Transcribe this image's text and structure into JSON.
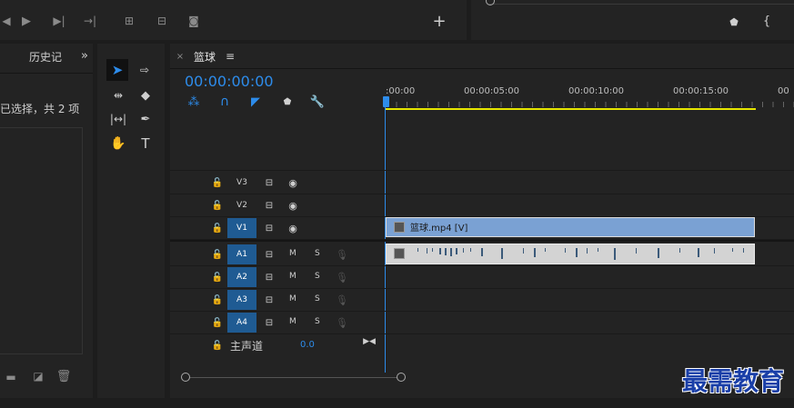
{
  "top_toolbar": {
    "icons": [
      "step-back-icon",
      "play-icon",
      "step-forward-icon",
      "go-to-out-icon",
      "insert-icon",
      "overwrite-icon",
      "export-frame-icon",
      "add-icon"
    ],
    "right_icons": [
      "marker-icon",
      "go-to-in-icon"
    ]
  },
  "project_panel": {
    "tab_label": "历史记",
    "status_text": "已选择，共 2 项",
    "bottom_icons": [
      "folder-icon",
      "new-item-icon",
      "trash-icon"
    ]
  },
  "timeline": {
    "sequence_name": "篮球",
    "timecode": "00:00:00:00",
    "ruler_labels": [
      ":00:00",
      "00:00:05:00",
      "00:00:10:00",
      "00:00:15:00",
      "00"
    ],
    "video_tracks": [
      {
        "name": "V3"
      },
      {
        "name": "V2"
      },
      {
        "name": "V1"
      }
    ],
    "audio_tracks": [
      {
        "name": "A1",
        "m": "M",
        "s": "S"
      },
      {
        "name": "A2",
        "m": "M",
        "s": "S"
      },
      {
        "name": "A3",
        "m": "M",
        "s": "S"
      },
      {
        "name": "A4",
        "m": "M",
        "s": "S"
      }
    ],
    "master": {
      "label": "主声道",
      "value": "0.0"
    },
    "video_clip": {
      "label": "篮球.mp4 [V]"
    }
  },
  "watermark": "最需教育",
  "colors": {
    "accent": "#2d8ceb",
    "clip_video": "#7aa1d3",
    "clip_audio": "#d3d3d3",
    "work_area": "#e6e600",
    "track_selected": "#1f5b93"
  }
}
